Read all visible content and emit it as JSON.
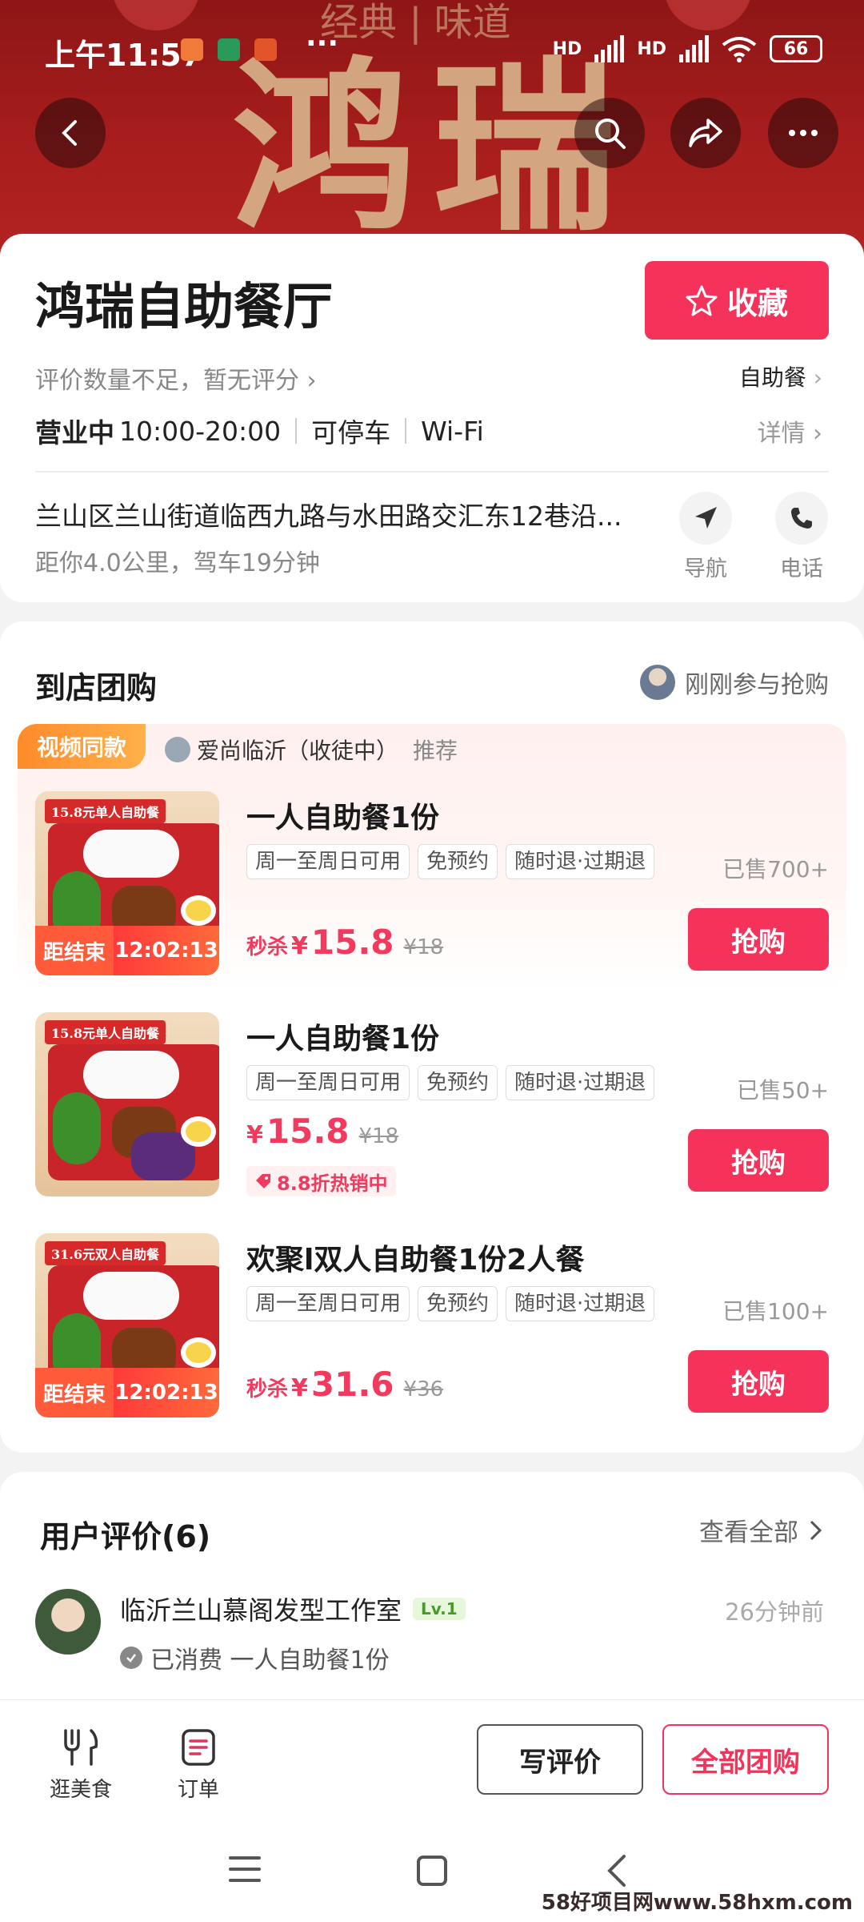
{
  "status_bar": {
    "time": "上午11:57",
    "signal_label": "HD",
    "signal_label2": "HD",
    "battery": "66"
  },
  "banner": {
    "brand_text": "鸿瑞",
    "top_text": "经典 | 味道"
  },
  "shop": {
    "name": "鸿瑞自助餐厅",
    "collect_label": "收藏",
    "rating_text": "评价数量不足，暂无评分",
    "category": "自助餐",
    "status": "营业中",
    "hours": "10:00-20:00",
    "parking": "可停车",
    "wifi": "Wi-Fi",
    "detail_label": "详情",
    "address": "兰山区兰山街道临西九路与水田路交汇东12巷沿...",
    "distance": "距你4.0公里，驾车19分钟",
    "nav_label": "导航",
    "phone_label": "电话"
  },
  "deals_section": {
    "title": "到店团购",
    "recent_label": "刚刚参与抢购",
    "video_tag": "视频同款",
    "recommender": "爱尚临沂（收徒中）",
    "recommend_label": "推荐",
    "items": [
      {
        "name": "一人自助餐1份",
        "thumb_label": "15.8元单人自助餐",
        "tags": [
          "周一至周日可用",
          "免预约",
          "随时退·过期退"
        ],
        "sold": "已售700+",
        "price_prefix": "秒杀",
        "currency": "¥",
        "price": "15.8",
        "original": "¥18",
        "countdown_label": "距结束",
        "countdown": "12:02:13",
        "buy_label": "抢购"
      },
      {
        "name": "一人自助餐1份",
        "thumb_label": "15.8元单人自助餐",
        "tags": [
          "周一至周日可用",
          "免预约",
          "随时退·过期退"
        ],
        "sold": "已售50+",
        "currency": "¥",
        "price": "15.8",
        "original": "¥18",
        "discount": "8.8折热销中",
        "buy_label": "抢购"
      },
      {
        "name": "欢聚l双人自助餐1份2人餐",
        "thumb_label": "31.6元双人自助餐",
        "tags": [
          "周一至周日可用",
          "免预约",
          "随时退·过期退"
        ],
        "sold": "已售100+",
        "price_prefix": "秒杀",
        "currency": "¥",
        "price": "31.6",
        "original": "¥36",
        "countdown_label": "距结束",
        "countdown": "12:02:13",
        "buy_label": "抢购"
      }
    ]
  },
  "reviews": {
    "title": "用户评价(6)",
    "view_all": "查看全部",
    "user": "临沂兰山慕阁发型工作室",
    "level": "Lv.1",
    "time": "26分钟前",
    "consumed": "已消费 一人自助餐1份"
  },
  "bottom_bar": {
    "nav_food": "逛美食",
    "nav_orders": "订单",
    "write_review": "写评价",
    "all_deals": "全部团购"
  },
  "watermark": "58好项目网www.58hxm.com",
  "colors": {
    "accent": "#f5335a",
    "banner": "#a81d1d",
    "countdown": "#ff5a3a"
  }
}
